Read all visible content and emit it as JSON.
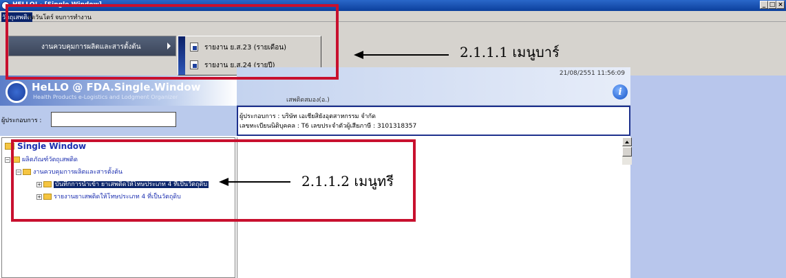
{
  "window": {
    "title": "HELLO! - [Single Window]"
  },
  "menubar": {
    "items": [
      "วัตถุเสพติด",
      "จัดวันโดร์",
      "จบการทำงาน"
    ]
  },
  "dropdown": {
    "item": "งานควบคุมการผลิตและสารตั้งต้น",
    "submenu": [
      "รายงาน ย.ส.23 (รายเดือน)",
      "รายงาน ย.ส.24 (รายปี)"
    ]
  },
  "logo": {
    "text": "HeLLO @ FDA.Single.Window",
    "tagline": "Health Products e-Logistics and Lodgment Organizer"
  },
  "header": {
    "department": "เสพติดสมอง(อ.)",
    "datetime": "21/08/2551 11:56:09"
  },
  "operator": {
    "label": "ผู้ประกอบการ :",
    "value": "",
    "company_line": "ผู้ประกอบการ : บริษัท เอเชียสิยังอุตสาหกรรม จำกัด",
    "tax_line": "เลขทะเบียนนิติบุคคล : T6 เลขประจำตัวผู้เสียภาษี : 3101318357"
  },
  "tree": {
    "root": "Single Window",
    "level1": "ผลิตภัณฑ์วัตถุเสพติด",
    "level2": "งานควบคุมการผลิตและสารตั้งต้น",
    "level3": [
      "บันทึกการนำเข้า ยาเสพติดให้โทษประเภท 4 ที่เป็นวัตถุดิบ",
      "รายงานยาเสพติดให้โทษประเภท 4 ที่เป็นวัตถุดิบ"
    ]
  },
  "annotations": {
    "menubar_label": "2.1.1.1 เมนูบาร์",
    "tree_label": "2.1.1.2 เมนูทรี"
  },
  "colors": {
    "highlight": "#0a246a",
    "annotation_red": "#c8102e",
    "panel_blue": "#b8c6ec"
  }
}
